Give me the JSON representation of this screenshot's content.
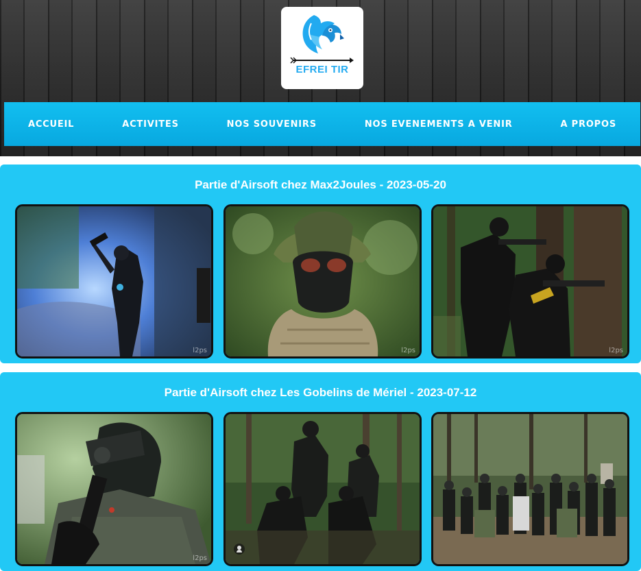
{
  "logo": {
    "text": "EFREI TIR",
    "icon": "eagle-arrow-logo-icon",
    "color": "#22aaf0"
  },
  "nav": {
    "items": [
      {
        "label": "ACCUEIL"
      },
      {
        "label": "ACTIVITES"
      },
      {
        "label": "NOS SOUVENIRS"
      },
      {
        "label": "NOS EVENEMENTS A VENIR"
      },
      {
        "label": "A PROPOS"
      }
    ],
    "color": "#12bff0"
  },
  "events": [
    {
      "title": "Partie d'Airsoft chez Max2Joules - 2023-05-20",
      "photos": [
        {
          "watermark": "l2ps"
        },
        {
          "watermark": "l2ps"
        },
        {
          "watermark": "l2ps"
        }
      ]
    },
    {
      "title": "Partie d'Airsoft chez Les Gobelins de Mériel - 2023-07-12",
      "photos": [
        {
          "watermark": "l2ps"
        },
        {
          "watermark": ""
        },
        {
          "watermark": ""
        }
      ]
    }
  ],
  "colors": {
    "section_bg": "#22c8f5",
    "header_bg": "#2a2a2a"
  }
}
